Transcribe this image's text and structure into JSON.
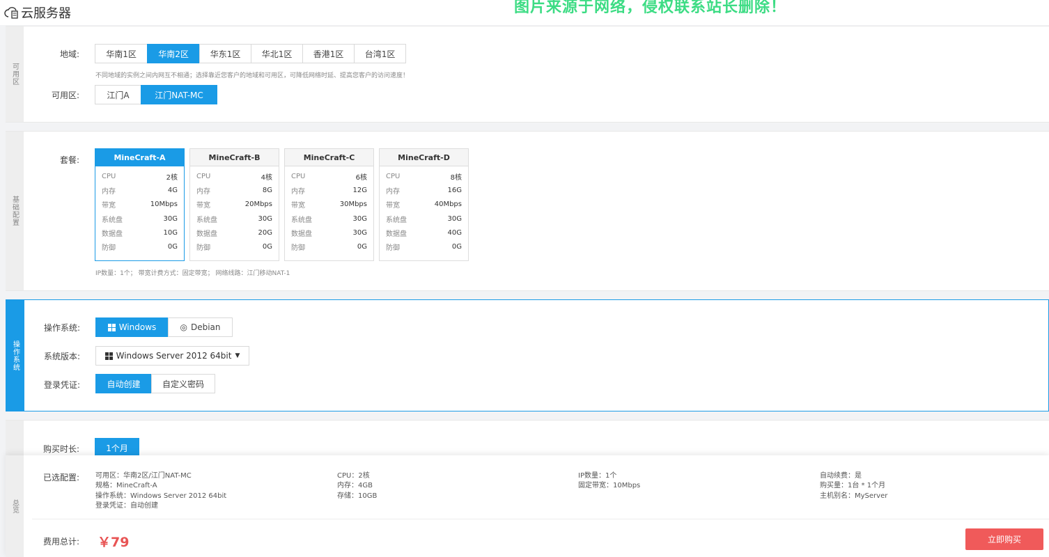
{
  "header": {
    "title": "云服务器",
    "watermark": "图片来源于网络，侵权联系站长删除！"
  },
  "region_section": {
    "side_label": "可用区",
    "region_label": "地域:",
    "regions": [
      "华南1区",
      "华南2区",
      "华东1区",
      "华北1区",
      "香港1区",
      "台湾1区"
    ],
    "selected_region": "华南2区",
    "hint": "不同地域的实例之间内网互不相通；选择靠近您客户的地域和可用区，可降低网络时延、提高您客户的访问速度！",
    "zone_label": "可用区:",
    "zones": [
      "江门A",
      "江门NAT-MC"
    ],
    "selected_zone": "江门NAT-MC"
  },
  "config_section": {
    "side_label": "基础配置",
    "plan_label": "套餐:",
    "plans": [
      {
        "name": "MineCraft-A",
        "rows": [
          [
            "CPU",
            "2核"
          ],
          [
            "内存",
            "4G"
          ],
          [
            "带宽",
            "10Mbps"
          ],
          [
            "系统盘",
            "30G"
          ],
          [
            "数据盘",
            "10G"
          ],
          [
            "防御",
            "0G"
          ]
        ]
      },
      {
        "name": "MineCraft-B",
        "rows": [
          [
            "CPU",
            "4核"
          ],
          [
            "内存",
            "8G"
          ],
          [
            "带宽",
            "20Mbps"
          ],
          [
            "系统盘",
            "30G"
          ],
          [
            "数据盘",
            "20G"
          ],
          [
            "防御",
            "0G"
          ]
        ]
      },
      {
        "name": "MineCraft-C",
        "rows": [
          [
            "CPU",
            "6核"
          ],
          [
            "内存",
            "12G"
          ],
          [
            "带宽",
            "30Mbps"
          ],
          [
            "系统盘",
            "30G"
          ],
          [
            "数据盘",
            "30G"
          ],
          [
            "防御",
            "0G"
          ]
        ]
      },
      {
        "name": "MineCraft-D",
        "rows": [
          [
            "CPU",
            "8核"
          ],
          [
            "内存",
            "16G"
          ],
          [
            "带宽",
            "40Mbps"
          ],
          [
            "系统盘",
            "30G"
          ],
          [
            "数据盘",
            "40G"
          ],
          [
            "防御",
            "0G"
          ]
        ]
      }
    ],
    "selected_plan": "MineCraft-A",
    "note": "IP数量：1个；  带宽计费方式：固定带宽；  网络线路：江门移动NAT-1"
  },
  "os_section": {
    "side_label": "操作系统",
    "os_label": "操作系统:",
    "os_options": [
      "Windows",
      "Debian"
    ],
    "selected_os": "Windows",
    "version_label": "系统版本:",
    "version_value": "Windows Server 2012 64bit",
    "cred_label": "登录凭证:",
    "cred_options": [
      "自动创建",
      "自定义密码"
    ],
    "selected_cred": "自动创建"
  },
  "duration_section": {
    "label": "购买时长:",
    "value": "1个月"
  },
  "summary": {
    "side_label": "总览",
    "selected_label": "已选配置:",
    "col1": [
      "可用区：华南2区/江门NAT-MC",
      "规格：MineCraft-A",
      "操作系统：Windows Server 2012 64bit",
      "登录凭证：自动创建"
    ],
    "col2": [
      "CPU：2核",
      "内存：4GB",
      "存储：10GB"
    ],
    "col3": [
      "IP数量：1个",
      "固定带宽：10Mbps"
    ],
    "col4": [
      "自动续费：是",
      "购买量：1台 * 1个月",
      "主机别名：MyServer"
    ],
    "total_label": "费用总计:",
    "total_price": "￥79",
    "buy_button": "立即购买"
  },
  "colors": {
    "accent": "#1a9be6",
    "price": "#e85454",
    "buy": "#f05a5a",
    "watermark": "#3ddc84"
  }
}
